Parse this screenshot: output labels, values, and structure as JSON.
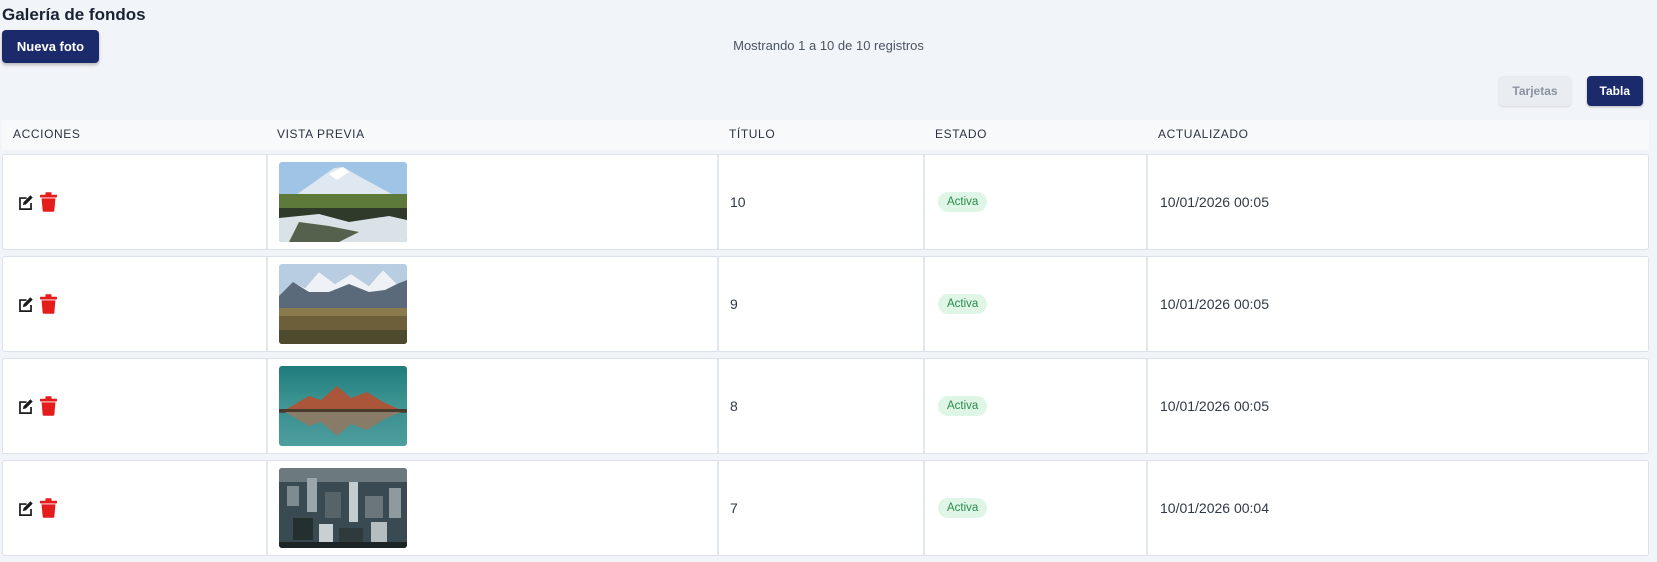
{
  "header": {
    "title": "Galería de fondos",
    "new_button": "Nueva foto",
    "records_info": "Mostrando 1 a 10 de 10 registros"
  },
  "view_toggle": {
    "cards": "Tarjetas",
    "table": "Tabla",
    "active": "table"
  },
  "table": {
    "columns": [
      "ACCIONES",
      "VISTA PREVIA",
      "TÍTULO",
      "ESTADO",
      "ACTUALIZADO"
    ],
    "rows": [
      {
        "title": "10",
        "status": "Activa",
        "updated": "10/01/2026 00:05",
        "preview": "volcano-waterfall"
      },
      {
        "title": "9",
        "status": "Activa",
        "updated": "10/01/2026 00:05",
        "preview": "snowy-mountain-range"
      },
      {
        "title": "8",
        "status": "Activa",
        "updated": "10/01/2026 00:05",
        "preview": "lake-reflection"
      },
      {
        "title": "7",
        "status": "Activa",
        "updated": "10/01/2026 00:04",
        "preview": "city-aerial"
      }
    ]
  },
  "colors": {
    "primary": "#1b2a6b",
    "delete": "#e41c1c",
    "badge_bg": "#dff6e6",
    "badge_text": "#2b8a4c"
  }
}
